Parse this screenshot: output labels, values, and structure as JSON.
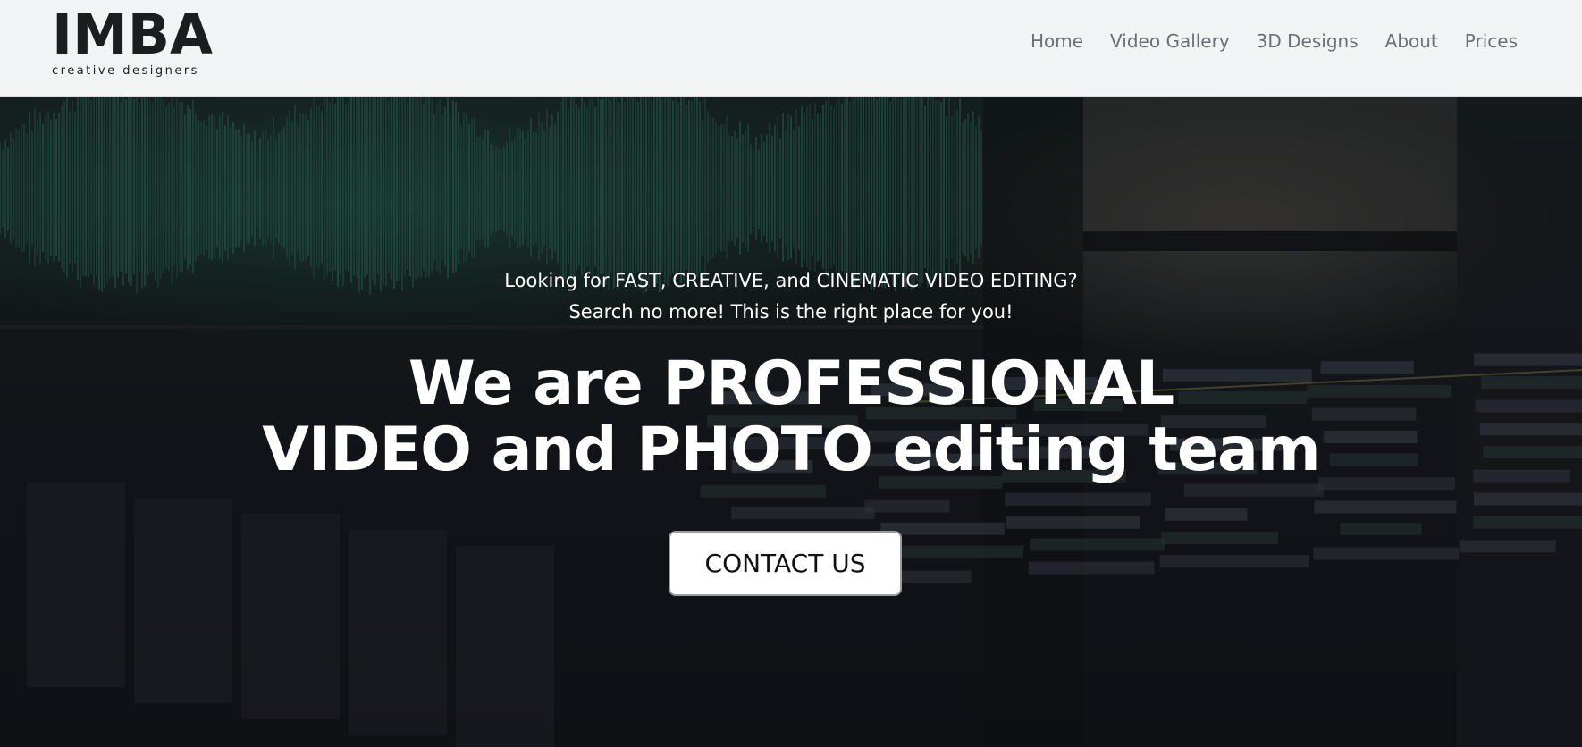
{
  "header": {
    "logo": {
      "wordmark": "IMBA",
      "tagline": "creative designers"
    },
    "nav": [
      {
        "label": "Home"
      },
      {
        "label": "Video Gallery"
      },
      {
        "label": "3D Designs"
      },
      {
        "label": "About"
      },
      {
        "label": "Prices"
      }
    ]
  },
  "hero": {
    "subtitle_line1": "Looking for FAST, CREATIVE, and CINEMATIC VIDEO EDITING?",
    "subtitle_line2": "Search no more! This is the right place for you!",
    "title_line1": "We are PROFESSIONAL",
    "title_line2": "VIDEO and PHOTO editing team",
    "cta_label": "CONTACT US"
  },
  "colors": {
    "header_bg": "#f2f3f5",
    "logo_text": "#1c1d21",
    "nav_text": "#6b6e75",
    "hero_text": "#ffffff",
    "button_bg": "#ffffff",
    "button_border": "#9a9ca1"
  }
}
